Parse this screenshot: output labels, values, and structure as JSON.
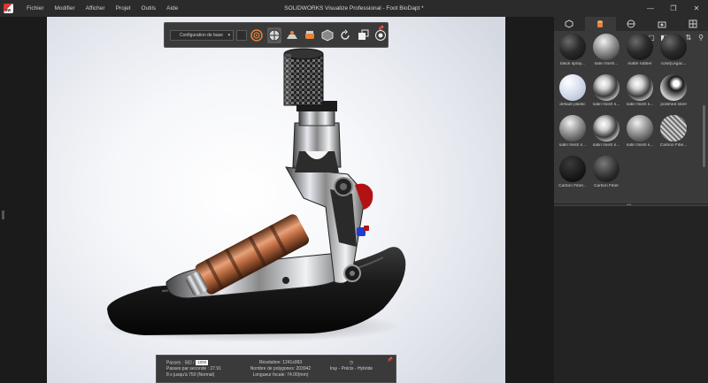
{
  "window": {
    "title": "SOLIDWORKS Visualize Professional - Foot BioDapt *",
    "logo_text": "sw"
  },
  "menu": [
    "Fichier",
    "Modifier",
    "Afficher",
    "Projet",
    "Outils",
    "Aide"
  ],
  "toolbar": {
    "configuration": "Configuration de base"
  },
  "status": {
    "passes_label": "Passes : 582 /",
    "passes_target": "1000",
    "passes_per_second": "Passes par seconde : 27.91",
    "time_left": "8 s jusqu'à 750 (Normal)",
    "resolution": "Résolution: 1241x993",
    "polygons": "Nombre de polygones: 203942",
    "focal": "Longueur focale: 74.00(mm)",
    "render_mode": "Iray - Précis - Hybride"
  },
  "library": {
    "materials": [
      {
        "label": "black spray...",
        "style": "dark"
      },
      {
        "label": "satin finish...",
        "style": "satin"
      },
      {
        "label": "matte rubber",
        "style": "dark"
      },
      {
        "label": "color[Legac...",
        "style": "dark"
      },
      {
        "label": "default plastic",
        "style": "plastic"
      },
      {
        "label": "satin finish s...",
        "style": "chrome"
      },
      {
        "label": "satin finish s...",
        "style": "chrome"
      },
      {
        "label": "polished steel",
        "style": "polished"
      },
      {
        "label": "satin finish s...",
        "style": "satin"
      },
      {
        "label": "satin finish s...",
        "style": "chrome"
      },
      {
        "label": "satin finish s...",
        "style": "satin"
      },
      {
        "label": "Carbon Fibe...",
        "style": "carbonlight"
      },
      {
        "label": "Carbon Fiber...",
        "style": "carbon"
      },
      {
        "label": "Carbon Fiber",
        "style": "carbon2"
      }
    ]
  },
  "colors": {
    "panel_bg": "#3a3a3a",
    "app_bg": "#1e1e1e",
    "accent": "#e8823a"
  }
}
